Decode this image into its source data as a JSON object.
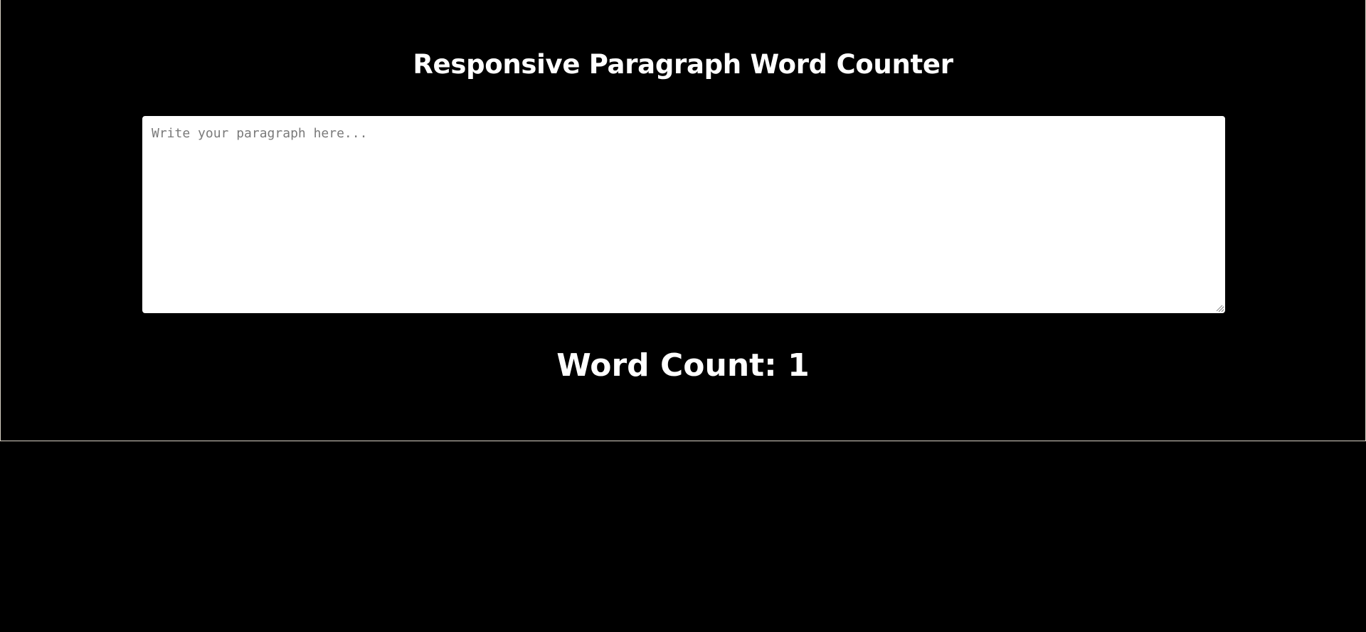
{
  "app": {
    "title": "Responsive Paragraph Word Counter"
  },
  "editor": {
    "placeholder": "Write your paragraph here...",
    "value": ""
  },
  "counter": {
    "label": "Word Count: ",
    "value": "1"
  },
  "colors": {
    "background": "#000000",
    "text": "#ffffff",
    "input_background": "#ffffff",
    "placeholder": "#7a7a7a",
    "container_border": "#d9d2c5"
  },
  "icons": {
    "resize": "resize-grip-icon"
  }
}
